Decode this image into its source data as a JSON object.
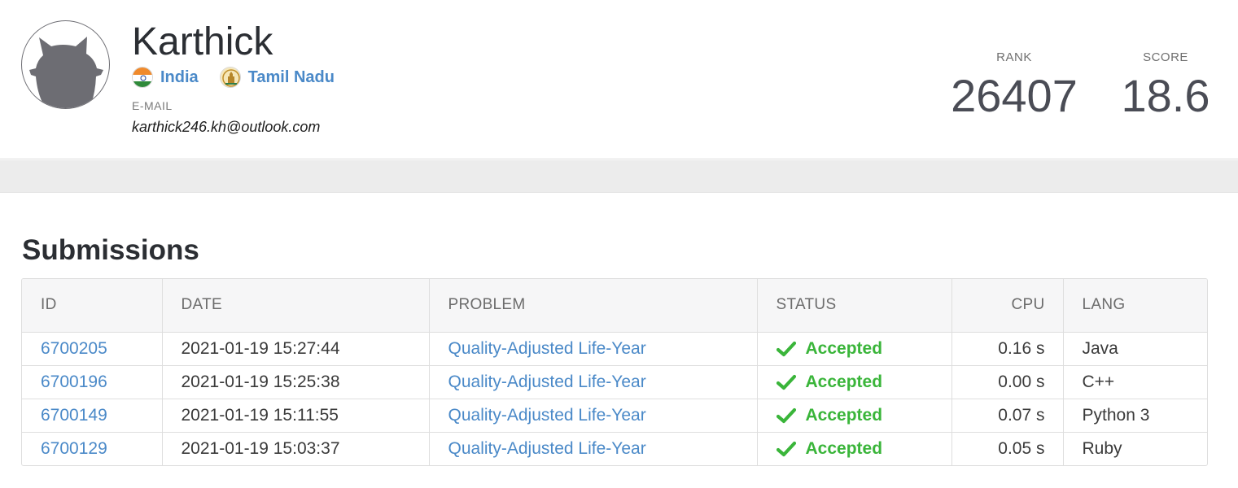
{
  "profile": {
    "name": "Karthick",
    "country": "India",
    "region": "Tamil Nadu",
    "email_label": "E-MAIL",
    "email": "karthick246.kh@outlook.com"
  },
  "stats": {
    "rank_label": "RANK",
    "rank_value": "26407",
    "score_label": "SCORE",
    "score_value": "18.6"
  },
  "submissions": {
    "title": "Submissions",
    "columns": [
      "ID",
      "DATE",
      "PROBLEM",
      "STATUS",
      "CPU",
      "LANG"
    ],
    "rows": [
      {
        "id": "6700205",
        "date": "2021-01-19 15:27:44",
        "problem": "Quality-Adjusted Life-Year",
        "status": "Accepted",
        "cpu": "0.16 s",
        "lang": "Java"
      },
      {
        "id": "6700196",
        "date": "2021-01-19 15:25:38",
        "problem": "Quality-Adjusted Life-Year",
        "status": "Accepted",
        "cpu": "0.00 s",
        "lang": "C++"
      },
      {
        "id": "6700149",
        "date": "2021-01-19 15:11:55",
        "problem": "Quality-Adjusted Life-Year",
        "status": "Accepted",
        "cpu": "0.07 s",
        "lang": "Python 3"
      },
      {
        "id": "6700129",
        "date": "2021-01-19 15:03:37",
        "problem": "Quality-Adjusted Life-Year",
        "status": "Accepted",
        "cpu": "0.05 s",
        "lang": "Ruby"
      }
    ]
  },
  "icons": {
    "avatar": "cat-silhouette-icon",
    "country_flag": "india-flag-icon",
    "region_emblem": "tamil-nadu-emblem-icon",
    "status": "check-icon"
  },
  "colors": {
    "link": "#4a89c8",
    "accepted": "#3ab53a",
    "avatar": "#6d6d73"
  }
}
